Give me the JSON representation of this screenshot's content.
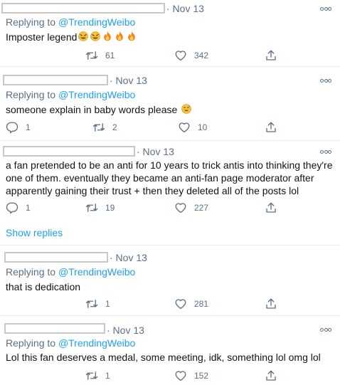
{
  "tweets": [
    {
      "date": "· Nov 13",
      "reply_prefix": "Replying to",
      "reply_handle": "@TrendingWeibo",
      "text": "Imposter legend",
      "emojis": [
        "rolling-laughing",
        "rolling-laughing",
        "fire",
        "fire",
        "fire"
      ],
      "counts": {
        "replies": "",
        "retweets": "61",
        "likes": "342"
      }
    },
    {
      "date": "· Nov 13",
      "reply_prefix": "Replying to",
      "reply_handle": "@TrendingWeibo",
      "text": "someone explain in baby words please",
      "emojis": [
        "sweat-smile"
      ],
      "counts": {
        "replies": "1",
        "retweets": "2",
        "likes": "10"
      }
    },
    {
      "date": "· Nov 13",
      "text_lines": [
        "a fan pretended to be an anti for 10 years to  trick antis into thinking they're",
        "one of them. eventually they became an anti-fan page moderator after",
        "apparently gaining their trust + then they deleted all of the posts lol"
      ],
      "counts": {
        "replies": "1",
        "retweets": "19",
        "likes": "227"
      }
    },
    {
      "date": "· Nov 13",
      "reply_prefix": "Replying to",
      "reply_handle": "@TrendingWeibo",
      "text": "that is dedication",
      "counts": {
        "replies": "",
        "retweets": "1",
        "likes": "281"
      }
    },
    {
      "date": "· Nov 13",
      "reply_prefix": "Replying to",
      "reply_handle": "@TrendingWeibo",
      "text": "Lol this fan deserves a medal, some meeting, idk, something lol omg lol",
      "counts": {
        "replies": "",
        "retweets": "1",
        "likes": "152"
      }
    }
  ],
  "show_replies_label": "Show replies",
  "colors": {
    "link": "#1da1f2",
    "muted": "#5b7083",
    "text": "#0f1419",
    "divider": "#e6ecf0",
    "redaction": "#c8c8c8"
  },
  "icons": [
    "reply-icon",
    "retweet-icon",
    "like-icon",
    "share-icon",
    "more-icon"
  ]
}
